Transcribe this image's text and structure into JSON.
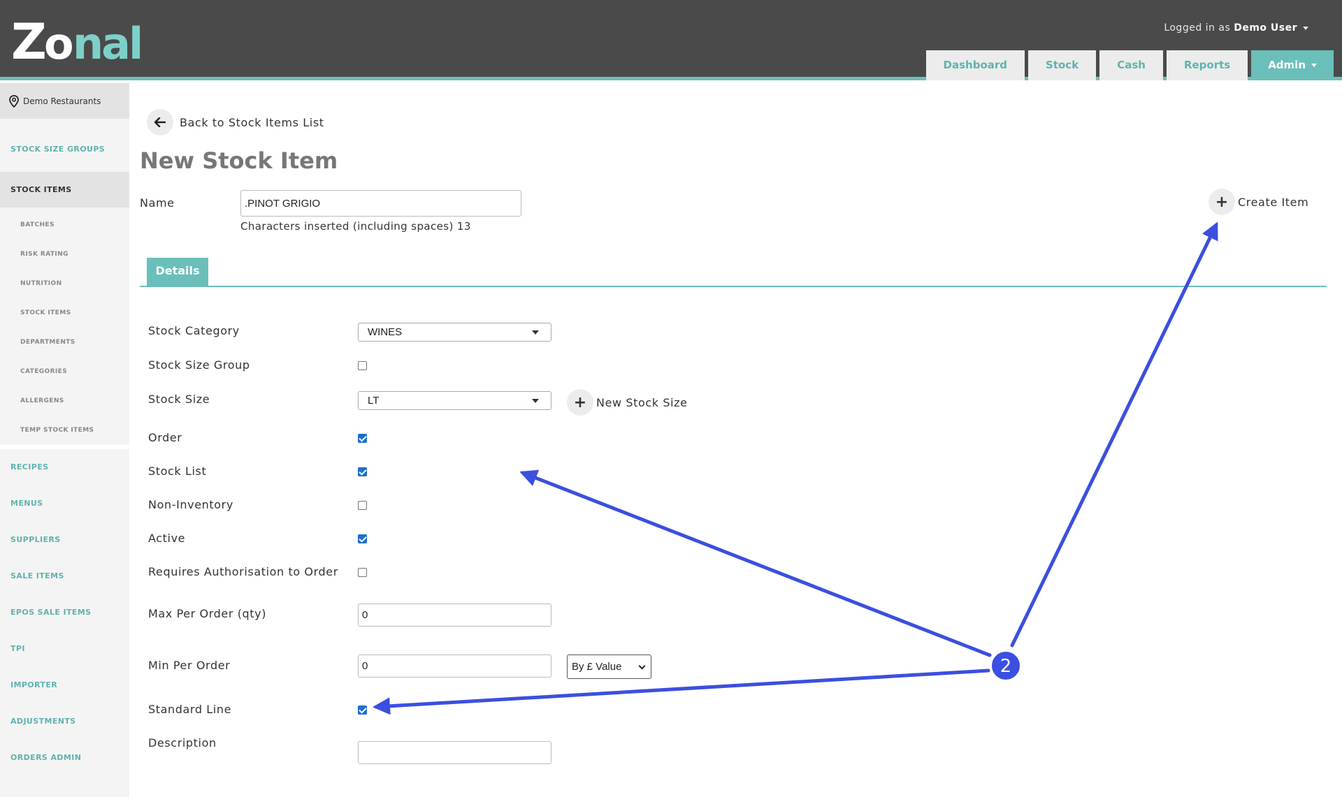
{
  "header": {
    "logo_text": "Zonal",
    "logged_in_prefix": "Logged in as",
    "user_name": "Demo User",
    "tabs": [
      {
        "label": "Dashboard"
      },
      {
        "label": "Stock"
      },
      {
        "label": "Cash"
      },
      {
        "label": "Reports"
      },
      {
        "label": "Admin"
      }
    ],
    "accent_color": "#6bbfba",
    "bar_color": "#4a4a4a"
  },
  "sidebar": {
    "location": "Demo Restaurants",
    "items": [
      {
        "label": "STOCK SIZE GROUPS"
      },
      {
        "label": "STOCK ITEMS"
      },
      {
        "label": "BATCHES"
      },
      {
        "label": "RISK RATING"
      },
      {
        "label": "NUTRITION"
      },
      {
        "label": "STOCK ITEMS"
      },
      {
        "label": "DEPARTMENTS"
      },
      {
        "label": "CATEGORIES"
      },
      {
        "label": "ALLERGENS"
      },
      {
        "label": "TEMP STOCK ITEMS"
      },
      {
        "label": "RECIPES"
      },
      {
        "label": "MENUS"
      },
      {
        "label": "SUPPLIERS"
      },
      {
        "label": "SALE ITEMS"
      },
      {
        "label": "EPOS SALE ITEMS"
      },
      {
        "label": "TPI"
      },
      {
        "label": "IMPORTER"
      },
      {
        "label": "ADJUSTMENTS"
      },
      {
        "label": "ORDERS ADMIN"
      }
    ]
  },
  "main": {
    "back_label": "Back to Stock Items List",
    "title": "New Stock Item",
    "name_label": "Name",
    "name_value": ".PINOT GRIGIO",
    "char_count_text": "Characters inserted (including spaces) 13",
    "create_label": "Create Item",
    "tab_label": "Details",
    "form": {
      "stock_category_label": "Stock Category",
      "stock_category_value": "WINES",
      "stock_size_group_label": "Stock Size Group",
      "stock_size_group_checked": false,
      "stock_size_label": "Stock Size",
      "stock_size_value": "LT",
      "new_stock_size_label": "New Stock Size",
      "order_label": "Order",
      "order_checked": true,
      "stock_list_label": "Stock List",
      "stock_list_checked": true,
      "non_inventory_label": "Non-Inventory",
      "non_inventory_checked": false,
      "active_label": "Active",
      "active_checked": true,
      "requires_auth_label": "Requires Authorisation to Order",
      "requires_auth_checked": false,
      "max_per_order_label": "Max Per Order (qty)",
      "max_per_order_value": "0",
      "min_per_order_label": "Min Per Order",
      "min_per_order_value": "0",
      "min_per_order_mode": "By £ Value",
      "standard_line_label": "Standard Line",
      "standard_line_checked": true,
      "description_label": "Description",
      "description_value": ""
    }
  },
  "annotation": {
    "marker_number": "2",
    "color": "#3b4fe0"
  }
}
